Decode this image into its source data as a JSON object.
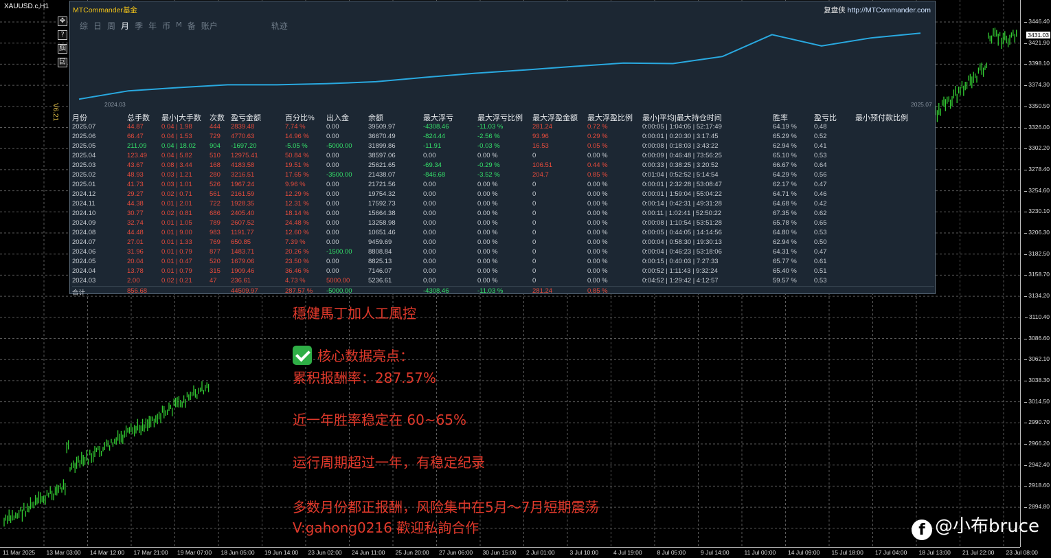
{
  "chart": {
    "symbol": "XAUUSD.c,H1",
    "version_label": "V6.21",
    "controls": [
      "✥",
      "?",
      "腘",
      "囙"
    ],
    "current_price": "3431.03",
    "price_ticks": [
      "3446.40",
      "3421.90",
      "3398.10",
      "3374.30",
      "3350.50",
      "3326.00",
      "3302.20",
      "3278.40",
      "3254.60",
      "3230.10",
      "3206.30",
      "3182.50",
      "3158.70",
      "3134.20",
      "3110.40",
      "3086.60",
      "3062.10",
      "3038.30",
      "3014.50",
      "2990.70",
      "2966.20",
      "2942.40",
      "2918.60",
      "2894.80"
    ],
    "time_ticks": [
      "11 Mar 2025",
      "13 Mar 03:00",
      "14 Mar 12:00",
      "17 Mar 21:00",
      "19 Mar 07:00",
      "18 Jun 05:00",
      "19 Jun 14:00",
      "23 Jun 02:00",
      "24 Jun 11:00",
      "25 Jun 20:00",
      "27 Jun 06:00",
      "30 Jun 15:00",
      "2 Jul 01:00",
      "3 Jul 10:00",
      "4 Jul 19:00",
      "8 Jul 05:00",
      "9 Jul 14:00",
      "11 Jul 00:00",
      "14 Jul 09:00",
      "15 Jul 18:00",
      "17 Jul 04:00",
      "18 Jul 13:00",
      "21 Jul 22:00",
      "23 Jul 08:00"
    ],
    "colors": {
      "candles": "#33cc33",
      "grid": "#5a5a5a"
    }
  },
  "panel": {
    "brand": "MTCommander",
    "brand_suffix": "基金",
    "link_label": "复盘侠",
    "link_url": "http://MTCommander.com",
    "tabs": [
      {
        "label": "综",
        "active": false
      },
      {
        "label": "日",
        "active": false
      },
      {
        "label": "周",
        "active": false
      },
      {
        "label": "月",
        "active": true
      },
      {
        "label": "季",
        "active": false
      },
      {
        "label": "年",
        "active": false
      },
      {
        "label": "币",
        "active": false
      },
      {
        "label": "M",
        "active": false
      },
      {
        "label": "备",
        "active": false
      },
      {
        "label": "账户",
        "active": false
      },
      {
        "label": "轨迹",
        "active": false
      }
    ],
    "equity": {
      "start_label": "2024.03",
      "end_label": "2025.07",
      "line_color": "#29a9e0"
    },
    "table": {
      "headers": [
        "月份",
        "总手数",
        "最小|大手数",
        "次数",
        "盈亏金额",
        "百分比%",
        "出入金",
        "余额",
        "最大浮亏",
        "最大浮亏比例",
        "最大浮盈金额",
        "最大浮盈比例",
        "最小|平均|最大持仓时间",
        "胜率",
        "盈亏比",
        "最小预付款比例"
      ],
      "rows": [
        [
          "2025.07",
          "44.87",
          "0.04 | 1.98",
          "444",
          "2839.48",
          "7.74 %",
          "0.00",
          "39509.97",
          "-4308.46",
          "-11.03 %",
          "281.24",
          "0.72 %",
          "0:00:05 | 1:04:05 | 52:17:49",
          "64.19 %",
          "0.48"
        ],
        [
          "2025.06",
          "66.47",
          "0.04 | 1.53",
          "729",
          "4770.63",
          "14.96 %",
          "0.00",
          "36670.49",
          "-824.44",
          "-2.56 %",
          "93.96",
          "0.29 %",
          "0:00:01 | 0:20:30 | 3:17:45",
          "65.29 %",
          "0.52"
        ],
        [
          "2025.05",
          "211.09",
          "0.04 | 18.02",
          "904",
          "-1697.20",
          "-5.05 %",
          "-5000.00",
          "31899.86",
          "-11.91",
          "-0.03 %",
          "16.53",
          "0.05 %",
          "0:00:08 | 0:18:03 | 3:43:22",
          "62.94 %",
          "0.41"
        ],
        [
          "2025.04",
          "123.49",
          "0.04 | 5.82",
          "510",
          "12975.41",
          "50.84 %",
          "0.00",
          "38597.06",
          "0.00",
          "0.00 %",
          "0",
          "0.00 %",
          "0:00:09 | 0:46:48 | 73:56:25",
          "65.10 %",
          "0.53"
        ],
        [
          "2025.03",
          "43.67",
          "0.08 | 3.44",
          "168",
          "4183.58",
          "19.51 %",
          "0.00",
          "25621.65",
          "-69.34",
          "-0.29 %",
          "106.51",
          "0.44 %",
          "0:00:33 | 0:38:25 | 3:20:52",
          "66.67 %",
          "0.64"
        ],
        [
          "2025.02",
          "48.93",
          "0.03 | 1.21",
          "280",
          "3216.51",
          "17.65 %",
          "-3500.00",
          "21438.07",
          "-846.68",
          "-3.52 %",
          "204.7",
          "0.85 %",
          "0:01:04 | 0:52:52 | 5:14:54",
          "64.29 %",
          "0.56"
        ],
        [
          "2025.01",
          "41.73",
          "0.03 | 1.01",
          "526",
          "1967.24",
          "9.96 %",
          "0.00",
          "21721.56",
          "0.00",
          "0.00 %",
          "0",
          "0.00 %",
          "0:00:01 | 2:32:28 | 53:08:47",
          "62.17 %",
          "0.47"
        ],
        [
          "2024.12",
          "29.27",
          "0.02 | 0.71",
          "561",
          "2161.59",
          "12.29 %",
          "0.00",
          "19754.32",
          "0.00",
          "0.00 %",
          "0",
          "0.00 %",
          "0:00:01 | 1:59:04 | 55:04:22",
          "64.71 %",
          "0.46"
        ],
        [
          "2024.11",
          "44.38",
          "0.01 | 2.01",
          "722",
          "1928.35",
          "12.31 %",
          "0.00",
          "17592.73",
          "0.00",
          "0.00 %",
          "0",
          "0.00 %",
          "0:00:14 | 0:42:31 | 49:31:28",
          "64.68 %",
          "0.42"
        ],
        [
          "2024.10",
          "30.77",
          "0.02 | 0.81",
          "686",
          "2405.40",
          "18.14 %",
          "0.00",
          "15664.38",
          "0.00",
          "0.00 %",
          "0",
          "0.00 %",
          "0:00:11 | 1:02:41 | 52:50:22",
          "67.35 %",
          "0.62"
        ],
        [
          "2024.09",
          "32.74",
          "0.01 | 1.05",
          "789",
          "2607.52",
          "24.48 %",
          "0.00",
          "13258.98",
          "0.00",
          "0.00 %",
          "0",
          "0.00 %",
          "0:00:08 | 1:10:54 | 53:51:28",
          "65.78 %",
          "0.65"
        ],
        [
          "2024.08",
          "44.48",
          "0.01 | 9.00",
          "983",
          "1191.77",
          "12.60 %",
          "0.00",
          "10651.46",
          "0.00",
          "0.00 %",
          "0",
          "0.00 %",
          "0:00:05 | 0:44:05 | 14:14:56",
          "64.80 %",
          "0.53"
        ],
        [
          "2024.07",
          "27.01",
          "0.01 | 1.33",
          "769",
          "650.85",
          "7.39 %",
          "0.00",
          "9459.69",
          "0.00",
          "0.00 %",
          "0",
          "0.00 %",
          "0:00:04 | 0:58:30 | 19:30:13",
          "62.94 %",
          "0.50"
        ],
        [
          "2024.06",
          "31.96",
          "0.01 | 0.79",
          "877",
          "1483.71",
          "20.26 %",
          "-1500.00",
          "8808.84",
          "0.00",
          "0.00 %",
          "0",
          "0.00 %",
          "0:00:04 | 0:46:23 | 53:18:06",
          "64.31 %",
          "0.47"
        ],
        [
          "2024.05",
          "20.04",
          "0.01 | 0.47",
          "520",
          "1679.06",
          "23.50 %",
          "0.00",
          "8825.13",
          "0.00",
          "0.00 %",
          "0",
          "0.00 %",
          "0:00:15 | 0:40:03 | 7:27:33",
          "65.77 %",
          "0.61"
        ],
        [
          "2024.04",
          "13.78",
          "0.01 | 0.79",
          "315",
          "1909.46",
          "36.46 %",
          "0.00",
          "7146.07",
          "0.00",
          "0.00 %",
          "0",
          "0.00 %",
          "0:00:52 | 1:11:43 | 9:32:24",
          "65.40 %",
          "0.51"
        ],
        [
          "2024.03",
          "2.00",
          "0.02 | 0.21",
          "47",
          "236.61",
          "4.73 %",
          "5000.00",
          "5236.61",
          "0.00",
          "0.00 %",
          "0",
          "0.00 %",
          "0:04:52 | 1:29:42 | 4:12:57",
          "59.57 %",
          "0.53"
        ]
      ],
      "total": [
        "合计",
        "856.68",
        "",
        "",
        "44509.97",
        "287.57 %",
        "-5000.00",
        "",
        "-4308.46",
        "-11.03 %",
        "281.24",
        "0.85 %",
        "",
        "",
        ""
      ]
    }
  },
  "caption": {
    "line1": "穩健馬丁加人工風控",
    "line2": "核心数据亮点：",
    "line3": "累积报酬率：287.57%",
    "line4": "近一年胜率稳定在 60~65%",
    "line5": "运行周期超过一年，有稳定纪录",
    "line6": "多数月份都正报酬，风险集中在5月～7月短期震荡",
    "line7": "V:gahong0216  歡迎私詢合作"
  },
  "watermark": {
    "icon": "facebook-icon",
    "text": "@小布bruce"
  }
}
